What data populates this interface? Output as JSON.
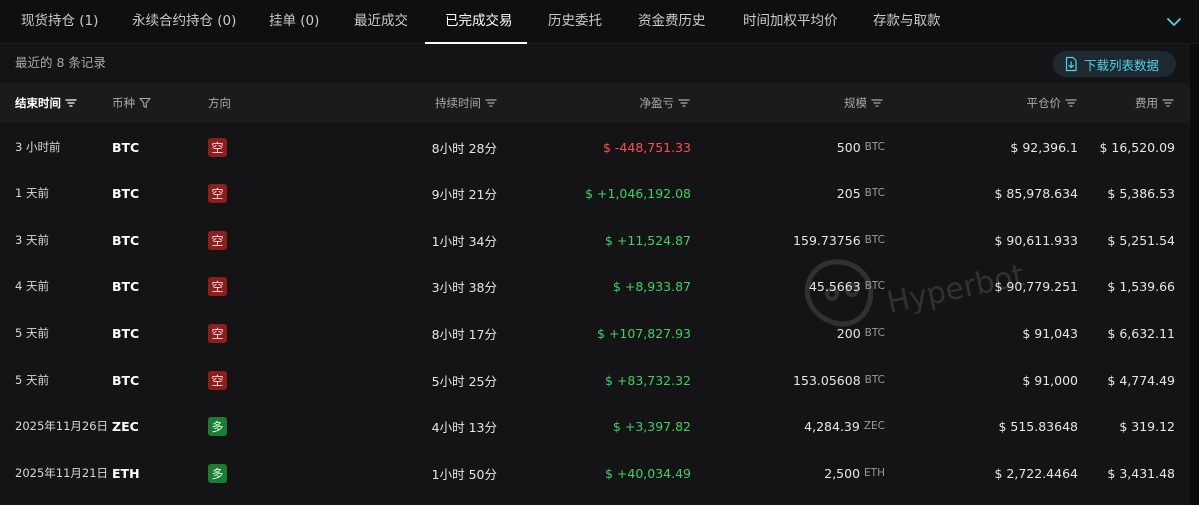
{
  "tabs": [
    {
      "label": "现货持仓 (1)"
    },
    {
      "label": "永续合约持仓 (0)"
    },
    {
      "label": "挂单 (0)"
    },
    {
      "label": "最近成交"
    },
    {
      "label": "已完成交易"
    },
    {
      "label": "历史委托"
    },
    {
      "label": "资金费历史"
    },
    {
      "label": "时间加权平均价"
    },
    {
      "label": "存款与取款"
    }
  ],
  "active_tab": "已完成交易",
  "records_label": "最近的 8 条记录",
  "download_label": "下载列表数据",
  "watermark_text": "Hyperbot",
  "colors": {
    "accent": "#4fd1e8",
    "profit": "#3ed160",
    "loss": "#ff4d4f",
    "short_badge": "#8e1e1e",
    "long_badge": "#1c7d32"
  },
  "table": {
    "headers": {
      "end_time": "结束时间",
      "coin": "币种",
      "direction": "方向",
      "duration": "持续时间",
      "pnl": "净盈亏",
      "size": "规模",
      "close_price": "平仓价",
      "fee": "费用"
    },
    "rows": [
      {
        "end_time": "3 小时前",
        "coin": "BTC",
        "direction": "空",
        "side": "short",
        "duration": "8小时 28分",
        "pnl": "$ -448,751.33",
        "pnl_sign": "neg",
        "size": "500",
        "size_unit": "BTC",
        "close_price": "$ 92,396.1",
        "fee": "$ 16,520.09"
      },
      {
        "end_time": "1 天前",
        "coin": "BTC",
        "direction": "空",
        "side": "short",
        "duration": "9小时 21分",
        "pnl": "$ +1,046,192.08",
        "pnl_sign": "pos",
        "size": "205",
        "size_unit": "BTC",
        "close_price": "$ 85,978.634",
        "fee": "$ 5,386.53"
      },
      {
        "end_time": "3 天前",
        "coin": "BTC",
        "direction": "空",
        "side": "short",
        "duration": "1小时 34分",
        "pnl": "$ +11,524.87",
        "pnl_sign": "pos",
        "size": "159.73756",
        "size_unit": "BTC",
        "close_price": "$ 90,611.933",
        "fee": "$ 5,251.54"
      },
      {
        "end_time": "4 天前",
        "coin": "BTC",
        "direction": "空",
        "side": "short",
        "duration": "3小时 38分",
        "pnl": "$ +8,933.87",
        "pnl_sign": "pos",
        "size": "45.5663",
        "size_unit": "BTC",
        "close_price": "$ 90,779.251",
        "fee": "$ 1,539.66"
      },
      {
        "end_time": "5 天前",
        "coin": "BTC",
        "direction": "空",
        "side": "short",
        "duration": "8小时 17分",
        "pnl": "$ +107,827.93",
        "pnl_sign": "pos",
        "size": "200",
        "size_unit": "BTC",
        "close_price": "$ 91,043",
        "fee": "$ 6,632.11"
      },
      {
        "end_time": "5 天前",
        "coin": "BTC",
        "direction": "空",
        "side": "short",
        "duration": "5小时 25分",
        "pnl": "$ +83,732.32",
        "pnl_sign": "pos",
        "size": "153.05608",
        "size_unit": "BTC",
        "close_price": "$ 91,000",
        "fee": "$ 4,774.49"
      },
      {
        "end_time": "2025年11月26日",
        "coin": "ZEC",
        "direction": "多",
        "side": "long",
        "duration": "4小时 13分",
        "pnl": "$ +3,397.82",
        "pnl_sign": "pos",
        "size": "4,284.39",
        "size_unit": "ZEC",
        "close_price": "$ 515.83648",
        "fee": "$ 319.12"
      },
      {
        "end_time": "2025年11月21日",
        "coin": "ETH",
        "direction": "多",
        "side": "long",
        "duration": "1小时 50分",
        "pnl": "$ +40,034.49",
        "pnl_sign": "pos",
        "size": "2,500",
        "size_unit": "ETH",
        "close_price": "$ 2,722.4464",
        "fee": "$ 3,431.48"
      }
    ]
  }
}
